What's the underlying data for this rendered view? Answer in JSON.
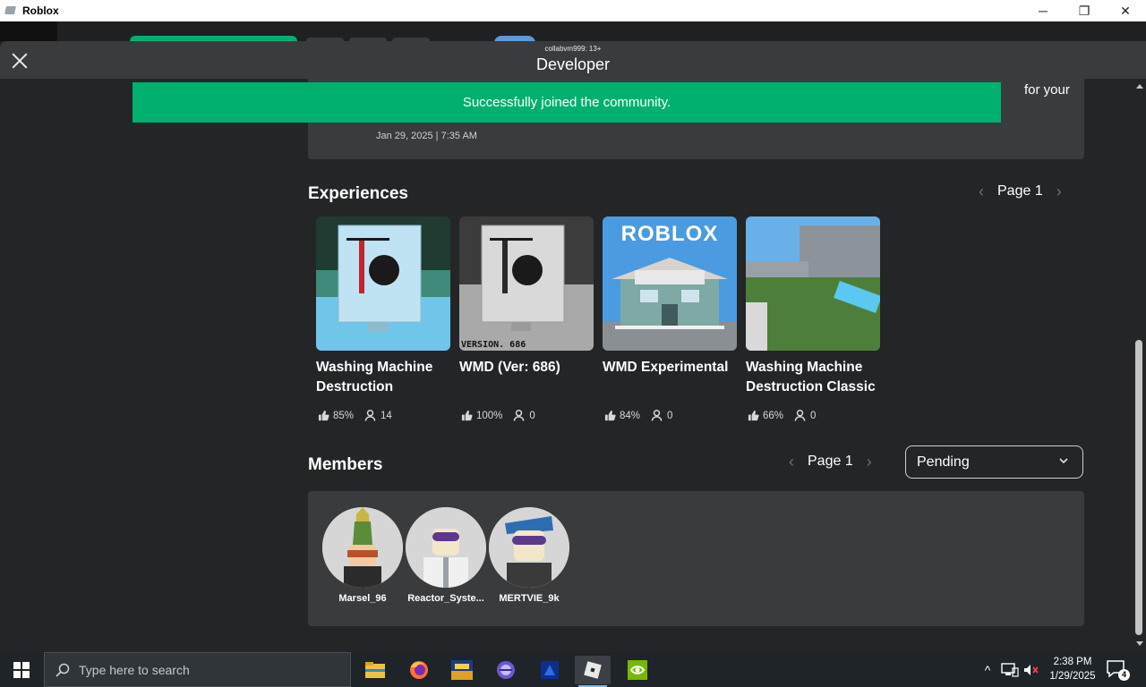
{
  "window": {
    "title": "Roblox",
    "minimize_glyph": "─",
    "restore_glyph": "❐",
    "close_glyph": "✕"
  },
  "header": {
    "username": "collabvm999: 13+",
    "title": "Developer"
  },
  "post": {
    "text_tail": "for your",
    "date": "Jan 29, 2025 | 7:35 AM"
  },
  "toast": {
    "message": "Successfully joined the community."
  },
  "experiences": {
    "title": "Experiences",
    "pager": {
      "label": "Page 1",
      "prev_glyph": "‹",
      "next_glyph": "›"
    },
    "items": [
      {
        "name": "Washing Machine Destruction",
        "rating": "85%",
        "players": "14"
      },
      {
        "name": "WMD (Ver: 686)",
        "rating": "100%",
        "players": "0",
        "thumb_caption": "VERSION. 686"
      },
      {
        "name": "WMD Experimental",
        "rating": "84%",
        "players": "0",
        "thumb_caption": "ROBLOX"
      },
      {
        "name": "Washing Machine Destruction Classic",
        "rating": "66%",
        "players": "0"
      }
    ]
  },
  "members": {
    "title": "Members",
    "pager": {
      "label": "Page 1",
      "prev_glyph": "‹",
      "next_glyph": "›"
    },
    "filter": {
      "selected": "Pending"
    },
    "items": [
      {
        "name": "Marsel_96"
      },
      {
        "name": "Reactor_Syste..."
      },
      {
        "name": "MERTVIE_9k"
      }
    ]
  },
  "taskbar": {
    "search_placeholder": "Type here to search",
    "tray_arrow": "^",
    "time": "2:38 PM",
    "date": "1/29/2025",
    "notification_count": "4"
  },
  "colors": {
    "accent_green": "#00b06f",
    "panel": "#393b3d",
    "background": "#232527"
  }
}
